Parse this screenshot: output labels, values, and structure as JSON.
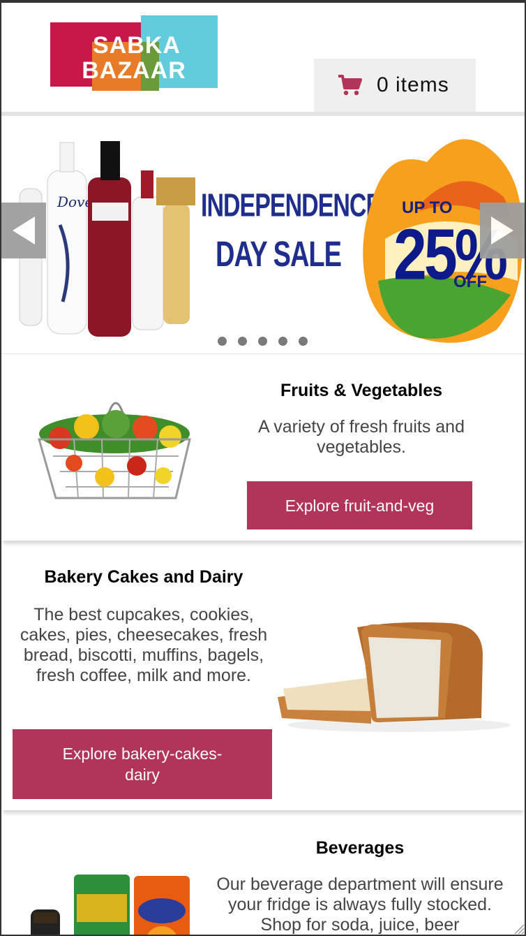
{
  "brand": {
    "line1": "SABKA",
    "line2": "BAZAAR"
  },
  "cart": {
    "label": "0 items"
  },
  "banner": {
    "headline_line1": "INDEPENDENCE",
    "headline_line2": "DAY SALE",
    "offer_prefix": "UP TO",
    "offer_value": "25%",
    "offer_suffix": "OFF",
    "slide_count": 5,
    "colors": {
      "headline": "#1f2e8c",
      "arrow_bg": "#9e9e9e"
    }
  },
  "categories": [
    {
      "title": "Fruits & Vegetables",
      "description": "A variety of fresh fruits and vegetables.",
      "button": "Explore fruit-and-veg",
      "image": "fruit-basket-image"
    },
    {
      "title": "Bakery Cakes and Dairy",
      "description": "The best cupcakes, cookies, cakes, pies, cheesecakes, fresh bread, biscotti, muffins, bagels, fresh coffee, milk and more.",
      "button": "Explore bakery-cakes-dairy",
      "image": "bread-slices-image"
    },
    {
      "title": "Beverages",
      "description": "Our beverage department will ensure your fridge is always fully stocked. Shop for soda, juice, beer",
      "image": "beverages-image"
    }
  ],
  "colors": {
    "accent": "#b03558",
    "cart_bg": "#efefef",
    "cart_icon": "#b03558"
  }
}
